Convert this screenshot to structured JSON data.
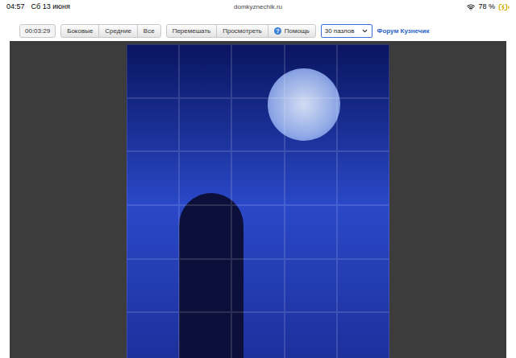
{
  "status_bar": {
    "time": "04:57",
    "date": "Сб 13 июня",
    "url": "domkyznechik.ru",
    "battery": "78 %",
    "charging": true
  },
  "toolbar": {
    "timer": "00:03:29",
    "groups": [
      [
        {
          "label": "Боковые"
        },
        {
          "label": "Средние"
        },
        {
          "label": "Все"
        }
      ],
      [
        {
          "label": "Перемешать"
        },
        {
          "label": "Просмотреть"
        },
        {
          "label": "Помощь",
          "icon": "?"
        }
      ]
    ],
    "select": {
      "value": "30 пазлов",
      "expanded": false
    },
    "link": "Форум Кузнечик"
  }
}
